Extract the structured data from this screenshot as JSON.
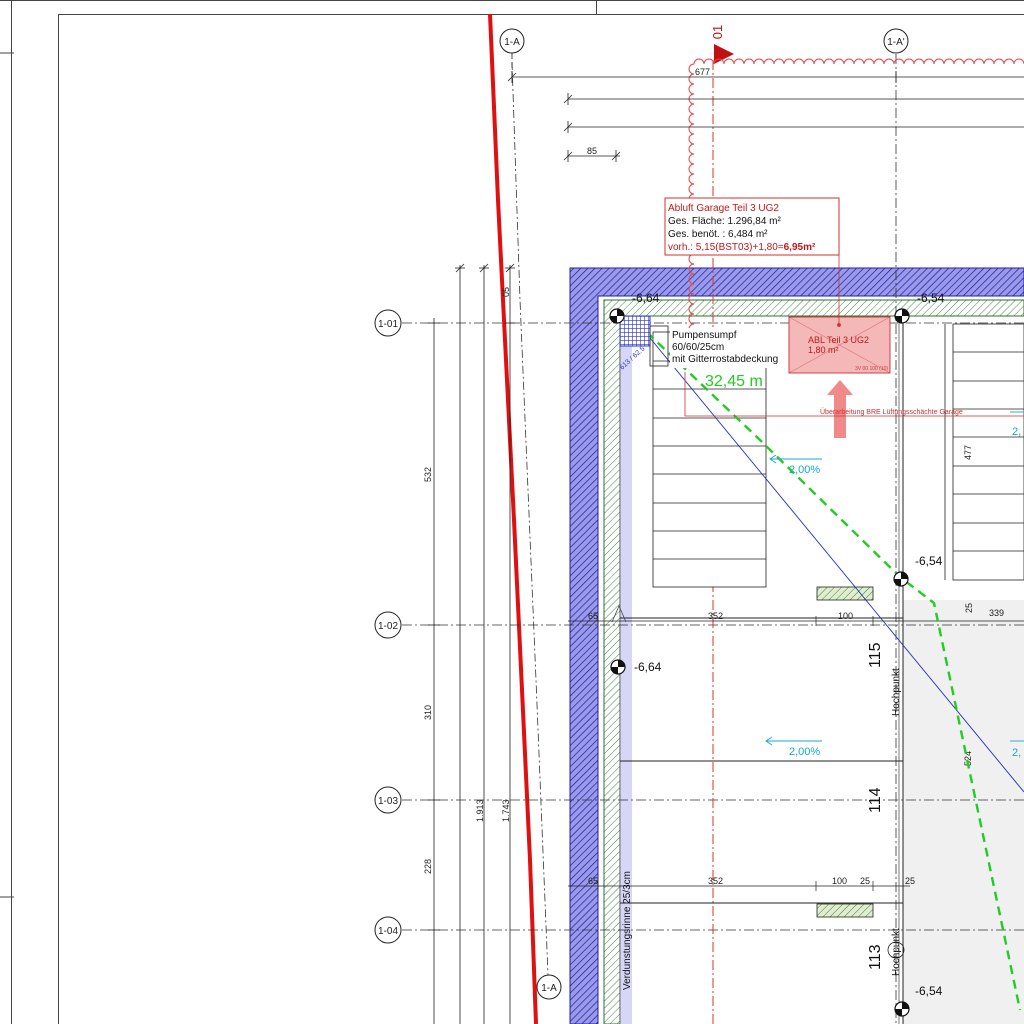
{
  "axes": {
    "vertical": [
      "1-A",
      "1-A'"
    ],
    "vertical_bottom": "1-A",
    "horizontal": [
      "1-01",
      "1-02",
      "1-03",
      "1-04"
    ]
  },
  "section_marker": "01",
  "dimensions": {
    "top_677": "677",
    "top_85": "85",
    "top_05": "05",
    "left_532": "532",
    "left_310": "310",
    "left_228": "228",
    "left_1913": "1.913",
    "left_1743": "1.743",
    "row1_65": "65",
    "row1_352": "352",
    "row1_100": "100",
    "row1_25": "25",
    "row1_339": "339",
    "row2_65": "65",
    "row2_352": "352",
    "row2_100": "100",
    "row2_25a": "25",
    "row2_25b": "25",
    "v_477": "477",
    "v_524": "524"
  },
  "annotation": {
    "title": "Abluft Garage Teil 3 UG2",
    "line1": "Ges. Fläche: 1.296,84 m²",
    "line2": "Ges. benöt. : 6,484 m²",
    "line3_prefix": "vorh.: 5,15(BST03)+1,80=",
    "line3_value": "6,95m²"
  },
  "abl": {
    "title": "ABL Teil 3 UG2",
    "area": "1,80 m²",
    "small": "3V 00 100 (10)"
  },
  "ueberarbeitung": "Überarbeitung BRE Lüftungsschächte Garage",
  "pump": {
    "line1": "Pumpensumpf",
    "line2": "60/60/25cm",
    "line3": "mit Gitterrostabdeckung",
    "tag": "613 / 62.5"
  },
  "elevations": {
    "e1": "-6,64",
    "e2": "-6,54",
    "e3": "-6,54",
    "e4": "-6,64",
    "e5": "-6,54"
  },
  "slopes": {
    "s1": "2,00%",
    "s2": "2,00%",
    "s3": "2,",
    "s4": "2,"
  },
  "distance": "32,45 m",
  "bays": {
    "b1": "115",
    "b2": "114",
    "b3": "113"
  },
  "labels": {
    "hochpunkt1": "Hochpunkt",
    "hochpunkt2": "Hochpunkt",
    "rinne": "Verdunstungsrinne 25/3cm"
  },
  "colors": {
    "red_property_line": "#e01010",
    "green_path": "#22cc22",
    "wall_hatch": "#2020c0",
    "annotation_red": "#d01818",
    "slope_cyan": "#14a8c8"
  }
}
